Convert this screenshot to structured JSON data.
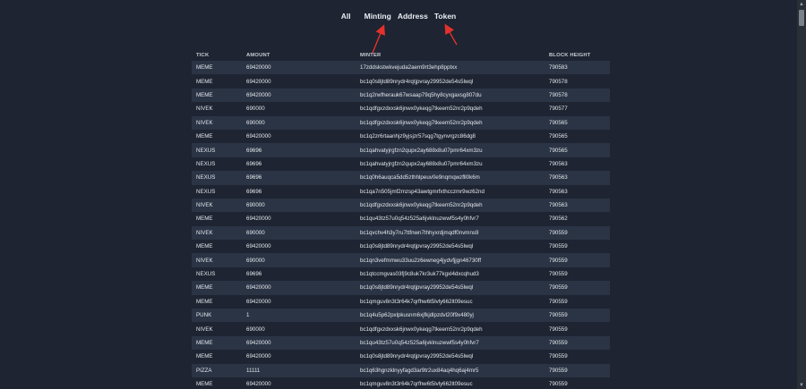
{
  "nav": {
    "all": "All",
    "minting": "Minting",
    "address": "Address",
    "token": "Token"
  },
  "table": {
    "headers": {
      "tick": "TICK",
      "amount": "AMOUNT",
      "minter": "MINTER",
      "block_height": "BLOCK HEIGHT"
    },
    "rows": [
      {
        "tick": "MEME",
        "amount": "69420000",
        "minter": "17zddskstwkvejuda2aem9rt3ehp8pptxx",
        "block": "790583"
      },
      {
        "tick": "MEME",
        "amount": "69420000",
        "minter": "bc1q0s8jtd89nrydr4rqtjpvray29952de54s5lwql",
        "block": "790578"
      },
      {
        "tick": "MEME",
        "amount": "69420000",
        "minter": "bc1q2rwfherauk67wsaap79q5hy8cyxgaxsg807du",
        "block": "790578"
      },
      {
        "tick": "NIVEK",
        "amount": "690000",
        "minter": "bc1qdfgxzdxxsk6jnwx0ykeqg7tkeem52nr2p9qdeh",
        "block": "790577"
      },
      {
        "tick": "NIVEK",
        "amount": "690000",
        "minter": "bc1qdfgxzdxxsk6jnwx0ykeqg7tkeem52nr2p9qdeh",
        "block": "790565"
      },
      {
        "tick": "MEME",
        "amount": "69420000",
        "minter": "bc1q2zr6rtaanhjz9yjsjzr57sqg7tgynvrgzc86dg8",
        "block": "790565"
      },
      {
        "tick": "NEXUS",
        "amount": "69696",
        "minter": "bc1qahvatyjrgfzn2qupx2ay688x8u07pmr64xm3zu",
        "block": "790565"
      },
      {
        "tick": "NEXUS",
        "amount": "69696",
        "minter": "bc1qahvatyjrgfzn2qupx2ay688x8u07pmr64xm3zu",
        "block": "790563"
      },
      {
        "tick": "NEXUS",
        "amount": "69696",
        "minter": "bc1q0h6auqca5dd5zthhlpeuv0e9nqmqwzfll0k6m",
        "block": "790563"
      },
      {
        "tick": "NEXUS",
        "amount": "69696",
        "minter": "bc1qa7n505jmf2mzsp43awtgmrfxthcczmr9wz62nd",
        "block": "790563"
      },
      {
        "tick": "NIVEK",
        "amount": "690000",
        "minter": "bc1qdfgxzdxxsk6jnwx0ykeqg7tkeem52nr2p9qdeh",
        "block": "790563"
      },
      {
        "tick": "MEME",
        "amount": "69420000",
        "minter": "bc1qu43tz57u0q54z525a6jvklnuzwwf5s4y0hfvr7",
        "block": "790562"
      },
      {
        "tick": "NIVEK",
        "amount": "690000",
        "minter": "bc1qvchv4h3y7ru7ttfnwn7thhyxrdjmqdf0nvmns9",
        "block": "790559"
      },
      {
        "tick": "MEME",
        "amount": "69420000",
        "minter": "bc1q0s8jtd89nrydr4rqtjpvray29952de54s5lwql",
        "block": "790559"
      },
      {
        "tick": "NIVEK",
        "amount": "690000",
        "minter": "bc1qn3vefmmwu33uu2z6ewneg4jydvfjjgn46730ff",
        "block": "790559"
      },
      {
        "tick": "NEXUS",
        "amount": "69696",
        "minter": "bc1qtccmgvas03fj9c8uk7kr3uk77kgxl4dxcqhud3",
        "block": "790559"
      },
      {
        "tick": "MEME",
        "amount": "69420000",
        "minter": "bc1q0s8jtd89nrydr4rqtjpvray29952de54s5lwql",
        "block": "790559"
      },
      {
        "tick": "MEME",
        "amount": "69420000",
        "minter": "bc1qmguv8n3t3r64k7qrfhw6t5lvly662lt09esuc",
        "block": "790559"
      },
      {
        "tick": "PUNK",
        "amount": "1",
        "minter": "bc1q4u5p62pxlpkusnm6xjfkjdlpzdvl20f9x480yj",
        "block": "790559"
      },
      {
        "tick": "NIVEK",
        "amount": "690000",
        "minter": "bc1qdfgxzdxxsk6jnwx0ykeqg7tkeem52nr2p9qdeh",
        "block": "790559"
      },
      {
        "tick": "MEME",
        "amount": "69420000",
        "minter": "bc1qu43tz57u0q54z525a6jvklnuzwwf5s4y0hfvr7",
        "block": "790559"
      },
      {
        "tick": "MEME",
        "amount": "69420000",
        "minter": "bc1q0s8jtd89nrydr4rqtjpvray29952de54s5lwql",
        "block": "790559"
      },
      {
        "tick": "PIZZA",
        "amount": "11111",
        "minter": "bc1q63hgnzklnyyfagd3ar9tr2ux84aq4hq6aj4mr5",
        "block": "790559"
      },
      {
        "tick": "MEME",
        "amount": "69420000",
        "minter": "bc1qmguv8n3t3r64k7qrfhw6t5lvly662lt09esuc",
        "block": "790559"
      }
    ]
  },
  "colors": {
    "background": "#1e2431",
    "row_alt": "#2b3445",
    "annotation_arrow": "#e5312b"
  }
}
